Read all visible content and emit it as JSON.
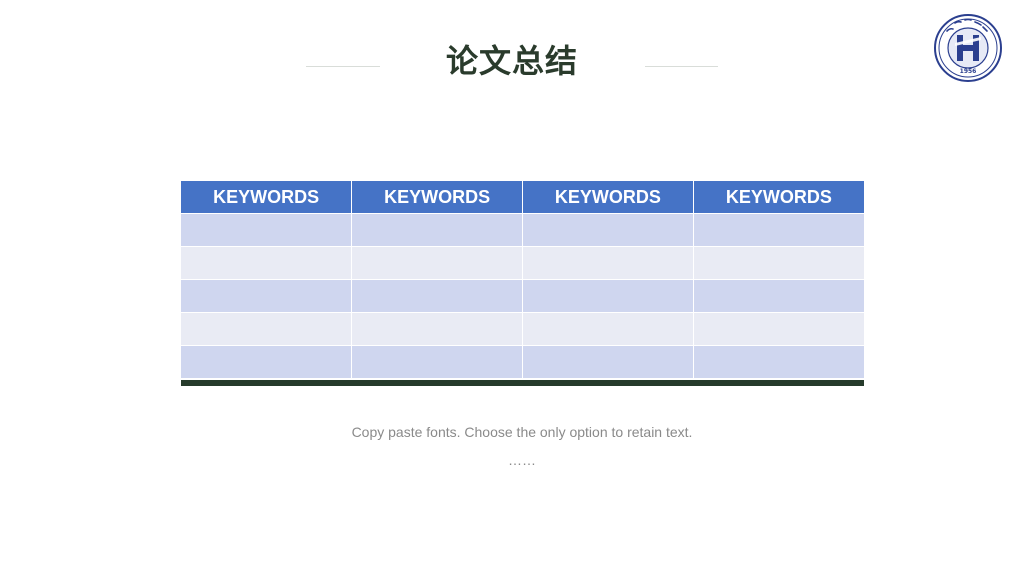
{
  "slide": {
    "title": "论文总结",
    "caption": "Copy paste fonts. Choose the only option to retain text.",
    "ellipsis": "……"
  },
  "logo": {
    "name": "university-seal",
    "year": "1956",
    "accent": "#2b3f8f"
  },
  "table": {
    "headers": [
      "KEYWORDS",
      "KEYWORDS",
      "KEYWORDS",
      "KEYWORDS"
    ],
    "rows": [
      [
        "",
        "",
        "",
        ""
      ],
      [
        "",
        "",
        "",
        ""
      ],
      [
        "",
        "",
        "",
        ""
      ],
      [
        "",
        "",
        "",
        ""
      ],
      [
        "",
        "",
        "",
        ""
      ]
    ],
    "colors": {
      "header": "#4573c6",
      "row_odd": "#cfd6ef",
      "row_even": "#e9ebf4",
      "bottom_bar": "#263b2b"
    }
  }
}
